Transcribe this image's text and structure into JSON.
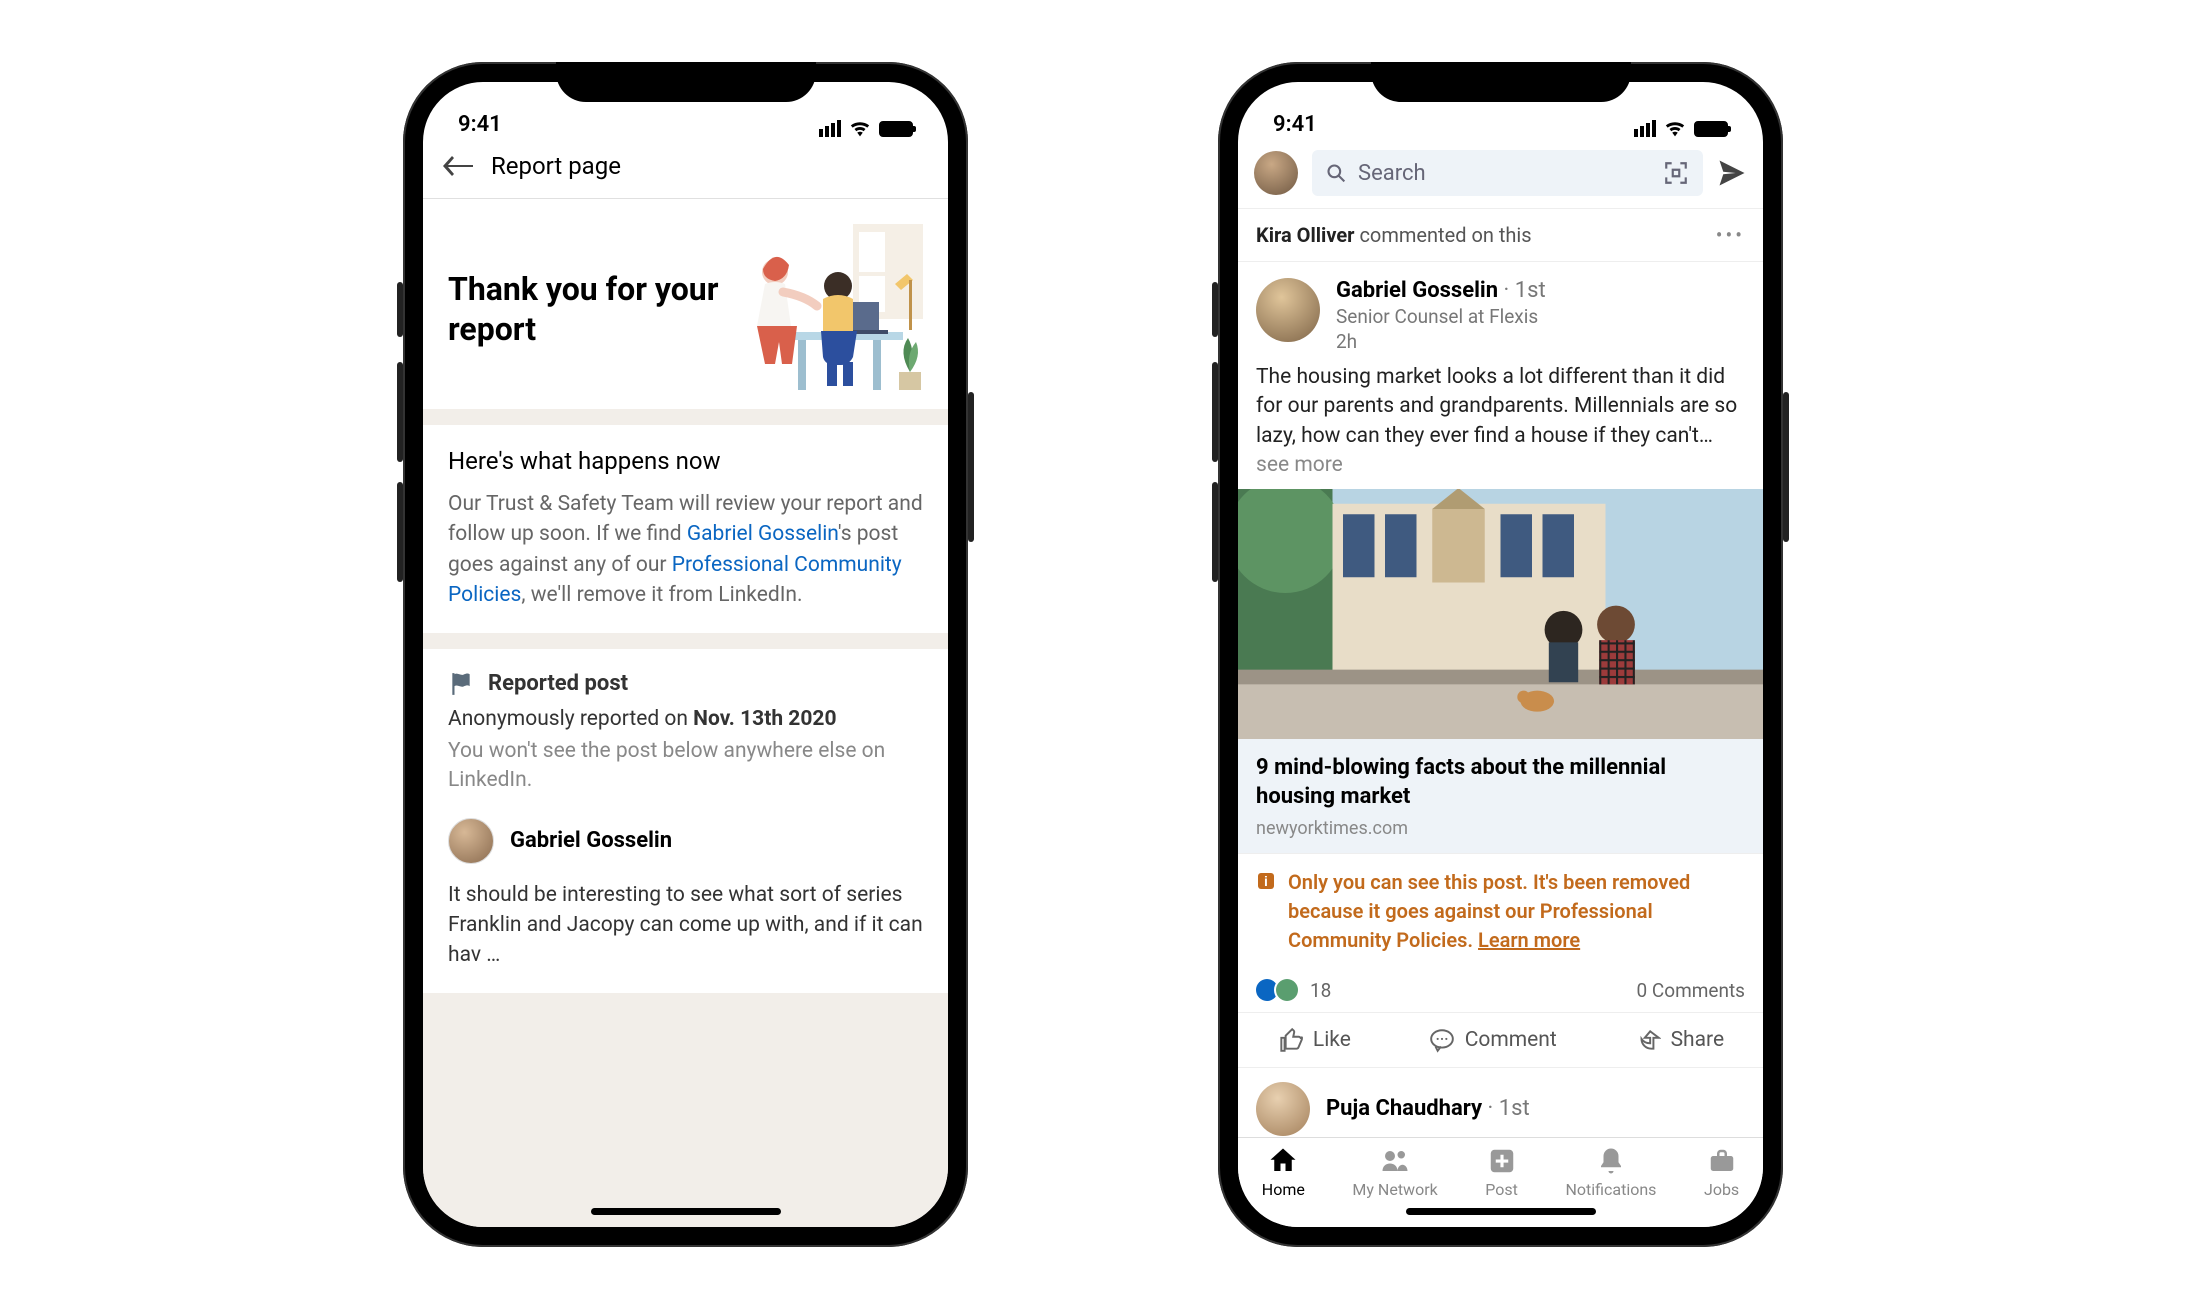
{
  "status": {
    "time": "9:41"
  },
  "phone1": {
    "nav_title": "Report page",
    "thankyou_title": "Thank you for your report",
    "happens_heading": "Here's what happens now",
    "happens_pre": "Our Trust & Safety Team will review your report and follow up soon. If we find ",
    "happens_linked_name": "Gabriel Gosselin",
    "happens_mid": "'s post goes against any of our ",
    "happens_policy_link": "Professional Community Policies",
    "happens_post": ", we'll remove it from LinkedIn.",
    "reported_label": "Reported post",
    "reported_prefix": "Anonymously reported on ",
    "reported_date": "Nov. 13th 2020",
    "reported_hint": "You won't see the post below anywhere else on LinkedIn.",
    "reported_user": "Gabriel Gosselin",
    "reported_excerpt": "It should be interesting to see what sort of series Franklin and Jacopy can come up with, and if it can hav …"
  },
  "phone2": {
    "search_placeholder": "Search",
    "context_name": "Kira Olliver",
    "context_action": " commented on this",
    "post": {
      "name": "Gabriel Gosselin",
      "degree": " · 1st",
      "subtitle": "Senior Counsel at Flexis",
      "time": "2h",
      "body": "The housing market looks a lot different than it did for our parents and grandparents. Millennials are so lazy, how can they ever find a house if they can't… ",
      "see_more": "see more",
      "article_title": "9 mind-blowing facts about the millennial housing market",
      "article_source": "newyorktimes.com"
    },
    "removed_msg": "Only you can see this post. It's been removed because it goes against our Professional Community Policies. ",
    "removed_learn": "Learn more",
    "reaction_count": "18",
    "comments": "0 Comments",
    "actions": {
      "like": "Like",
      "comment": "Comment",
      "share": "Share"
    },
    "next_post": {
      "name": "Puja Chaudhary",
      "degree": " · 1st"
    },
    "tabs": {
      "home": "Home",
      "network": "My Network",
      "post": "Post",
      "notifications": "Notifications",
      "jobs": "Jobs"
    }
  }
}
